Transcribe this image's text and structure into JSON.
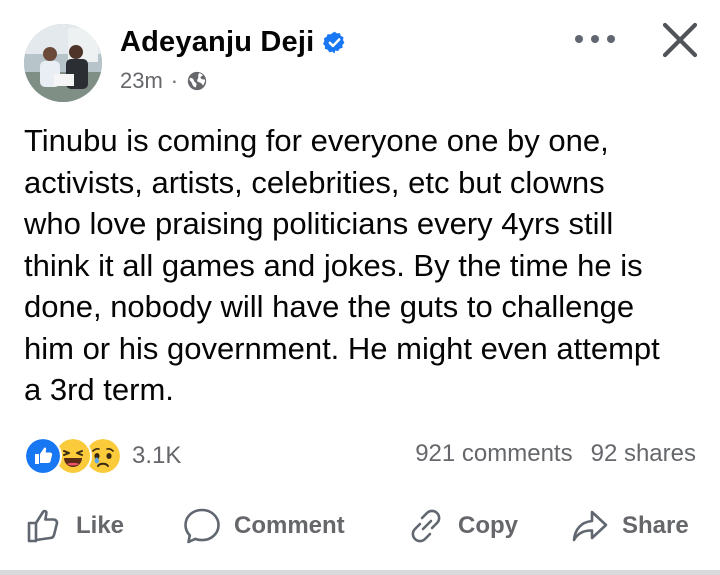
{
  "post": {
    "author": "Adeyanju Deji",
    "time": "23m",
    "separator": "·",
    "text": "Tinubu is coming for everyone one by one,\nactivists, artists, celebrities, etc but clowns\nwho love praising politicians every 4yrs still\nthink it all games and jokes. By the time he is\ndone, nobody will have the guts to challenge\nhim or his government. He might even attempt\na 3rd term."
  },
  "stats": {
    "reaction_count": "3.1K",
    "comments": "921 comments",
    "shares": "92 shares",
    "reactions": [
      "like-icon",
      "haha-icon",
      "sad-icon"
    ]
  },
  "actions": {
    "like": "Like",
    "comment": "Comment",
    "copy": "Copy",
    "share": "Share"
  },
  "colors": {
    "verified": "#1877f2",
    "secondary_text": "#65676b",
    "text": "#050505"
  }
}
